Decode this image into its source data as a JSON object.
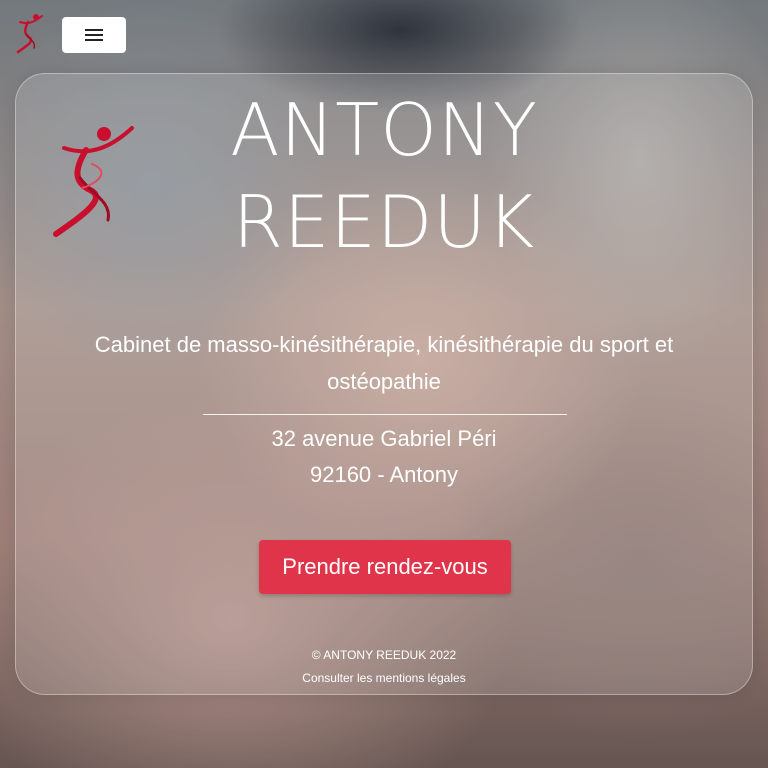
{
  "header": {
    "logo_icon": "runner-logo-icon",
    "menu_icon": "hamburger-menu-icon"
  },
  "hero": {
    "title_line1": "ANTONY",
    "title_line2": "REEDUK",
    "subtitle": "Cabinet de masso-kinésithérapie, kinésithérapie du sport et ostéopathie",
    "address_line1": "32 avenue Gabriel Péri",
    "address_line2": "92160 - Antony",
    "cta_label": "Prendre rendez-vous"
  },
  "footer": {
    "copyright": "© ANTONY REEDUK 2022",
    "legal_link": "Consulter les mentions légales"
  },
  "colors": {
    "accent": "#e0344a",
    "logo_red": "#c8102e",
    "text": "#ffffff"
  }
}
